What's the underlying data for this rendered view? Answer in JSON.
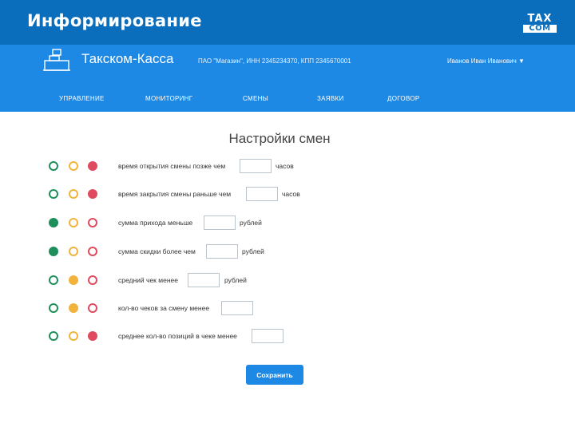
{
  "slide": {
    "title": "Информирование",
    "brand_top": "TAX",
    "brand_bottom": "COM"
  },
  "app": {
    "name": "Такском-Касса",
    "org_info": "ПАО \"Магазин\", ИНН 2345234370, КПП 2345670001",
    "user": "Иванов Иван Иванович ▼"
  },
  "nav": [
    "УПРАВЛЕНИЕ",
    "МОНИТОРИНГ",
    "СМЕНЫ",
    "ЗАЯВКИ",
    "ДОГОВОР"
  ],
  "page": {
    "heading": "Настройки смен",
    "save_label": "Сохранить"
  },
  "rules": [
    {
      "label": "время открытия смены позже чем",
      "value": "",
      "unit": "часов",
      "active": "red"
    },
    {
      "label": "время закрытия смены раньше чем",
      "value": "",
      "unit": "часов",
      "active": "red"
    },
    {
      "label": "сумма прихода меньше",
      "value": "",
      "unit": "рублей",
      "active": "green"
    },
    {
      "label": "сумма скидки более чем",
      "value": "",
      "unit": "рублей",
      "active": "green"
    },
    {
      "label": "средний чек менее",
      "value": "",
      "unit": "рублей",
      "active": "yellow"
    },
    {
      "label": "кол-во чеков за смену менее",
      "value": "",
      "unit": "",
      "active": "yellow"
    },
    {
      "label": "среднее кол-во позиций в чеке менее",
      "value": "",
      "unit": "",
      "active": "red"
    }
  ],
  "colors": {
    "header_bg": "#0a6ebd",
    "app_bar_bg": "#1e88e5",
    "status_green": "#1e8e5a",
    "status_yellow": "#f2b33d",
    "status_red": "#e04a5f"
  }
}
